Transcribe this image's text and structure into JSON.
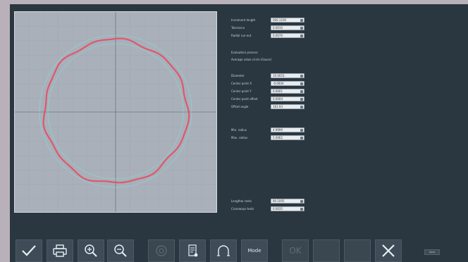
{
  "params_top": [
    {
      "label": "Increment length",
      "value": "000.1100"
    },
    {
      "label": "Tolerance",
      "value": "0.0010"
    },
    {
      "label": "Radial run-out",
      "value": "0.0070"
    }
  ],
  "evaluation": {
    "label": "Evaluation process",
    "value": "Average value circle (Gauss)"
  },
  "params_mid": [
    {
      "label": "Diameter",
      "value": "10.0053"
    },
    {
      "label": "Center point X",
      "value": "-0.0004"
    },
    {
      "label": "Center point Y",
      "value": "0.0001"
    },
    {
      "label": "Center point offset",
      "value": "0.0004"
    },
    {
      "label": "Offset angle",
      "value": "161.93"
    }
  ],
  "params_radius": [
    {
      "label": "Min. radius",
      "value": "4.9999"
    },
    {
      "label": "Max. radius",
      "value": "5.0062"
    }
  ],
  "params_bottom": [
    {
      "label": "Lengthw. tests",
      "value": "90.1005"
    },
    {
      "label": "Crossways tests",
      "value": "0.0035"
    }
  ],
  "toolbar": {
    "buttons": [
      {
        "name": "confirm-button",
        "icon": "check-icon"
      },
      {
        "name": "print-button",
        "icon": "printer-icon"
      },
      {
        "name": "zoom-in-button",
        "icon": "zoom-in-icon"
      },
      {
        "name": "zoom-out-button",
        "icon": "zoom-out-icon"
      },
      {
        "name": "center-button",
        "icon": "target-icon"
      },
      {
        "name": "report-button",
        "icon": "document-icon"
      },
      {
        "name": "profile-button",
        "icon": "arc-icon"
      },
      {
        "name": "mode-button",
        "icon": "",
        "label": "Mode"
      },
      {
        "name": "ok-button",
        "icon": "",
        "label": "OK"
      },
      {
        "name": "blank-button-1",
        "icon": ""
      },
      {
        "name": "blank-button-2",
        "icon": ""
      },
      {
        "name": "close-button",
        "icon": "close-icon"
      }
    ],
    "small_label": "Save"
  },
  "colors": {
    "screen_bg": "#2a3740",
    "plot_bg": "#a9b0ba",
    "trace": "#e0576a",
    "button_bg": "#3f4c57"
  }
}
